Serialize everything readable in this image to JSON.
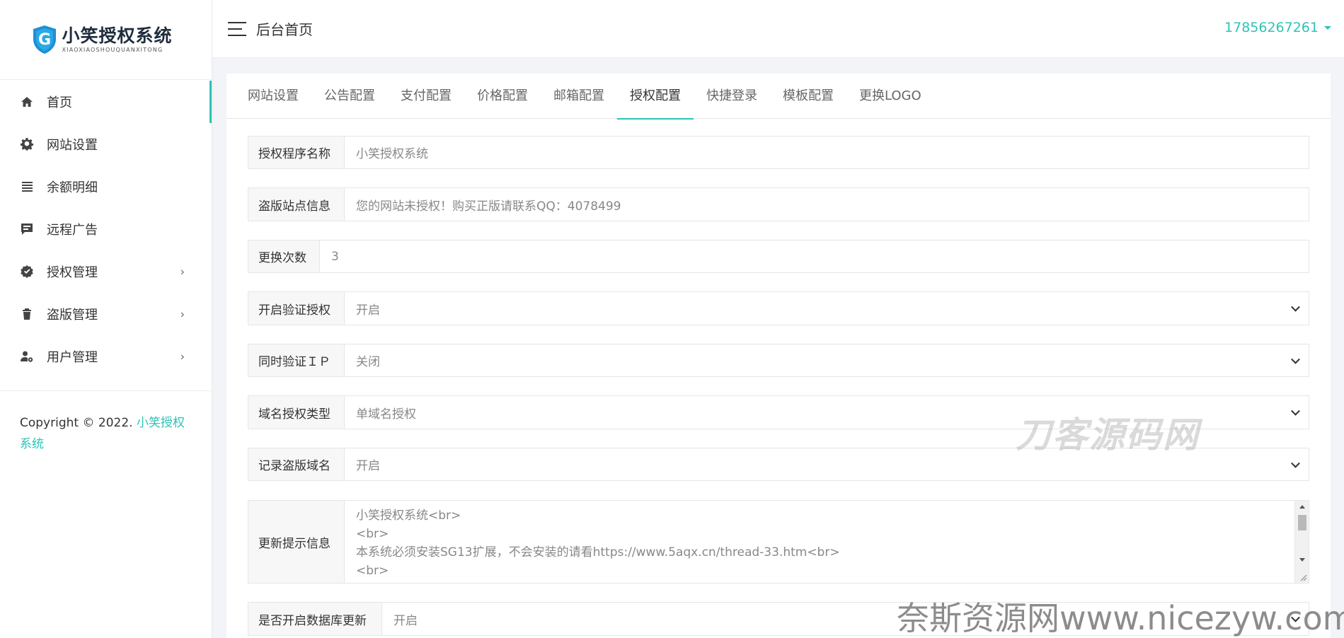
{
  "logo": {
    "cn": "小笑授权系统",
    "en": "XIAOXIAOSHOUQUANXITONG"
  },
  "sidebar": {
    "items": [
      {
        "label": "首页",
        "icon": "home-icon",
        "active": true,
        "has_children": false
      },
      {
        "label": "网站设置",
        "icon": "gear-icon",
        "active": false,
        "has_children": false
      },
      {
        "label": "余额明细",
        "icon": "list-icon",
        "active": false,
        "has_children": false
      },
      {
        "label": "远程广告",
        "icon": "message-icon",
        "active": false,
        "has_children": false
      },
      {
        "label": "授权管理",
        "icon": "badge-check-icon",
        "active": false,
        "has_children": true
      },
      {
        "label": "盗版管理",
        "icon": "trash-icon",
        "active": false,
        "has_children": true
      },
      {
        "label": "用户管理",
        "icon": "user-cog-icon",
        "active": false,
        "has_children": true
      }
    ],
    "copyright_prefix": "Copyright © 2022.",
    "copyright_link": "小笑授权系统"
  },
  "header": {
    "title": "后台首页",
    "user": "17856267261"
  },
  "tabs": [
    {
      "label": "网站设置",
      "active": false
    },
    {
      "label": "公告配置",
      "active": false
    },
    {
      "label": "支付配置",
      "active": false
    },
    {
      "label": "价格配置",
      "active": false
    },
    {
      "label": "邮箱配置",
      "active": false
    },
    {
      "label": "授权配置",
      "active": true
    },
    {
      "label": "快捷登录",
      "active": false
    },
    {
      "label": "模板配置",
      "active": false
    },
    {
      "label": "更换LOGO",
      "active": false
    }
  ],
  "form": {
    "program_name": {
      "label": "授权程序名称",
      "value": "小笑授权系统"
    },
    "pirate_info": {
      "label": "盗版站点信息",
      "value": "您的网站未授权！购买正版请联系QQ：4078499"
    },
    "change_count": {
      "label": "更换次数",
      "value": "3"
    },
    "enable_verify": {
      "label": "开启验证授权",
      "value": "开启"
    },
    "verify_ip": {
      "label": "同时验证ＩＰ",
      "value": "关闭"
    },
    "domain_type": {
      "label": "域名授权类型",
      "value": "单域名授权"
    },
    "record_pirate": {
      "label": "记录盗版域名",
      "value": "开启"
    },
    "update_message": {
      "label": "更新提示信息",
      "lines": [
        "小笑授权系统<br>",
        "<br>",
        "本系统必须安装SG13扩展，不会安装的请看https://www.5aqx.cn/thread-33.htm<br>",
        "<br>"
      ]
    },
    "db_update": {
      "label": "是否开启数据库更新",
      "value": "开启"
    }
  },
  "watermarks": {
    "top": "刀客源码网",
    "bottom": "奈斯资源网www.nicezyw.com"
  },
  "colors": {
    "accent": "#2ec4b6",
    "label_bg": "#f7f7f7"
  }
}
